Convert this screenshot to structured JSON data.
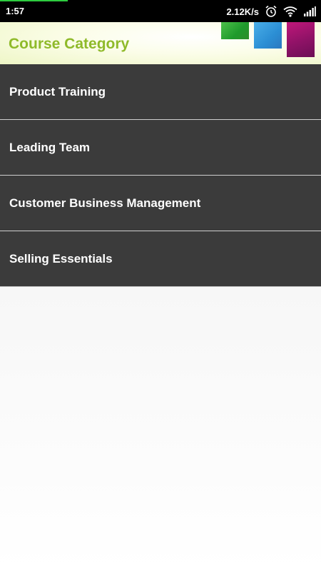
{
  "status_bar": {
    "time": "1:57",
    "net_speed": "2.12K/s",
    "icons": [
      "alarm-icon",
      "wifi-icon",
      "signal-icon"
    ],
    "loading_progress": 0.21
  },
  "header": {
    "title": "Course Category",
    "title_color": "#8fba2a"
  },
  "categories": [
    {
      "label": "Product Training"
    },
    {
      "label": "Leading Team"
    },
    {
      "label": "Customer Business Management"
    },
    {
      "label": "Selling Essentials"
    }
  ],
  "colors": {
    "list_background": "#3b3b3b",
    "list_text": "#ffffff",
    "status_bar": "#000000"
  }
}
